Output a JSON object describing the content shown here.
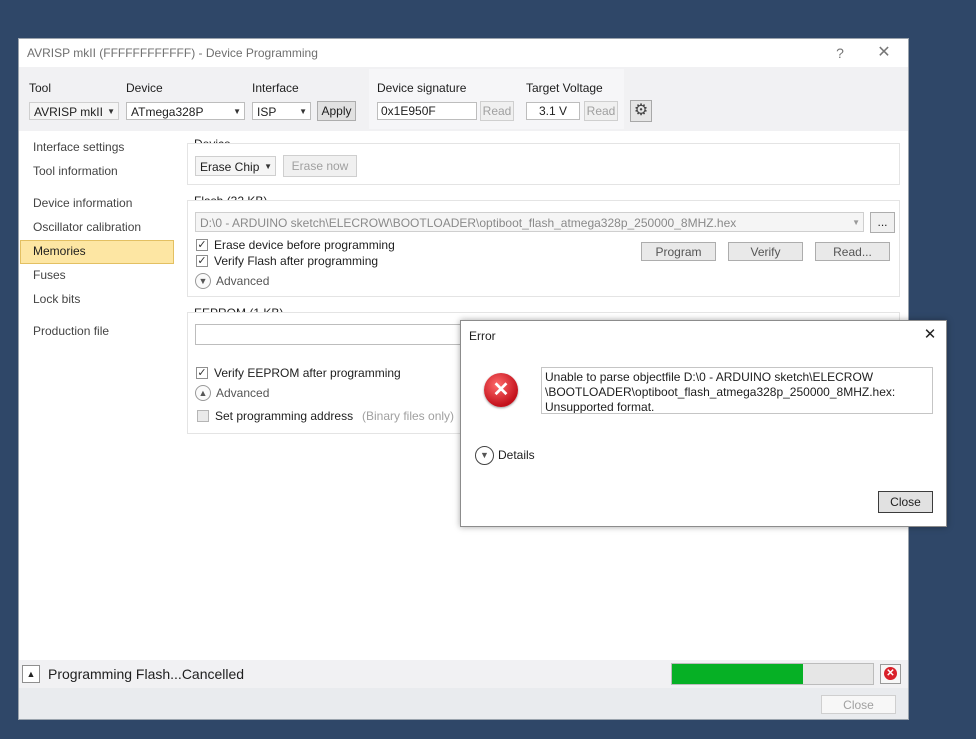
{
  "window": {
    "title": "AVRISP mkII (FFFFFFFFFFFF) - Device Programming",
    "help_icon": "question-mark-icon",
    "close_icon": "close-icon"
  },
  "toolbar": {
    "tool_label": "Tool",
    "tool_value": "AVRISP mkII",
    "device_label": "Device",
    "device_value": "ATmega328P",
    "interface_label": "Interface",
    "interface_value": "ISP",
    "apply_label": "Apply",
    "signature_label": "Device signature",
    "signature_value": "0x1E950F",
    "signature_read": "Read",
    "voltage_label": "Target Voltage",
    "voltage_value": "3.1 V",
    "voltage_read": "Read",
    "settings_icon": "gear-icon"
  },
  "sidebar": {
    "items": [
      {
        "label": "Interface settings"
      },
      {
        "label": "Tool information"
      },
      {
        "label": "Device information"
      },
      {
        "label": "Oscillator calibration"
      },
      {
        "label": "Memories",
        "selected": true
      },
      {
        "label": "Fuses"
      },
      {
        "label": "Lock bits"
      },
      {
        "label": "Production file"
      }
    ]
  },
  "device_section": {
    "title": "Device",
    "erase_select": "Erase Chip",
    "erase_now": "Erase now"
  },
  "flash_section": {
    "title": "Flash (32 KB)",
    "file_path": "D:\\0 - ARDUINO sketch\\ELECROW\\BOOTLOADER\\optiboot_flash_atmega328p_250000_8MHZ.hex",
    "browse": "...",
    "erase_before": "Erase device before programming",
    "verify_after": "Verify Flash after programming",
    "advanced": "Advanced",
    "program": "Program",
    "verify": "Verify",
    "read": "Read..."
  },
  "eeprom_section": {
    "title": "EEPROM (1 KB)",
    "file_path": "",
    "verify_after": "Verify EEPROM after programming",
    "advanced": "Advanced",
    "set_address": "Set programming address",
    "binary_only": "(Binary files only)"
  },
  "status": {
    "text": "Programming Flash...Cancelled",
    "progress": 0.65,
    "expand_icon": "triangle-up-icon",
    "cancel_icon": "cancel-x-icon",
    "progress_color": "#06b025"
  },
  "footer": {
    "close": "Close"
  },
  "error_dialog": {
    "title": "Error",
    "icon": "error-x-icon",
    "message": "Unable to parse objectfile D:\\0 - ARDUINO sketch\\ELECROW \\BOOTLOADER\\optiboot_flash_atmega328p_250000_8MHZ.hex: Unsupported format.",
    "details": "Details",
    "close": "Close",
    "error_color": "#d9202a"
  }
}
